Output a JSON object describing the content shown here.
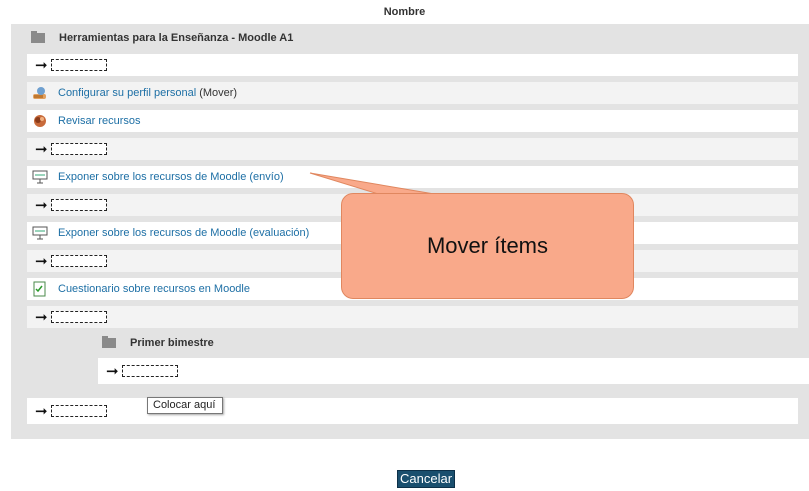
{
  "header": {
    "column_label": "Nombre"
  },
  "section": {
    "title": "Herramientas para la Enseñanza - Moodle A1"
  },
  "items": [
    {
      "label": "Configurar su perfil personal",
      "suffix": "(Mover)",
      "icon": "profile-icon"
    },
    {
      "label": "Revisar recursos",
      "icon": "resource-icon"
    },
    {
      "label": "Exponer sobre los recursos de Moodle (envío)",
      "icon": "assignment-icon"
    },
    {
      "label": "Exponer sobre los recursos de Moodle (evaluación)",
      "icon": "assignment-icon"
    },
    {
      "label": "Cuestionario sobre recursos en Moodle",
      "icon": "quiz-icon"
    }
  ],
  "subsection": {
    "title": "Primer bimestre"
  },
  "tooltip": {
    "text": "Colocar aquí"
  },
  "callout": {
    "text": "Mover ítems"
  },
  "actions": {
    "cancel_label": "Cancelar"
  },
  "colors": {
    "link": "#1d6fa5",
    "callout_fill": "#f9a98a",
    "callout_border": "#e0875f",
    "cancel_bg": "#1a4f6e"
  }
}
